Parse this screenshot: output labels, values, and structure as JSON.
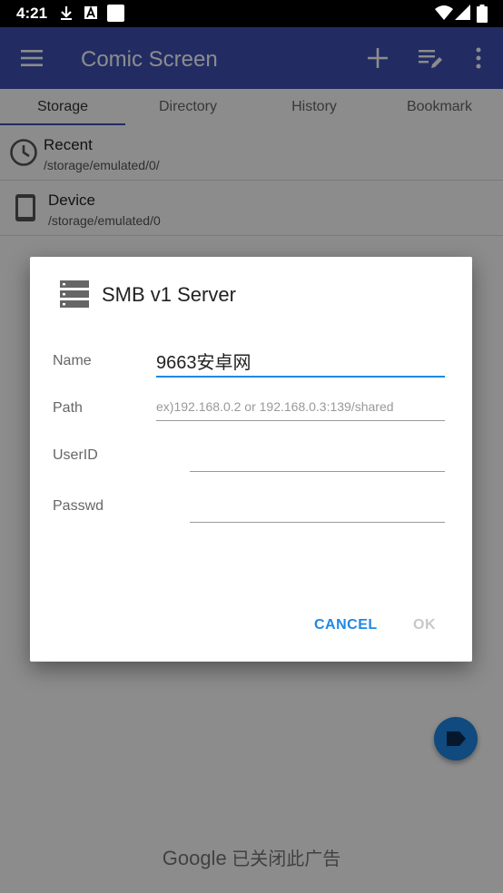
{
  "status_bar": {
    "time": "4:21",
    "icons": [
      "download-icon",
      "text-a-icon",
      "notification-square-icon",
      "wifi-icon",
      "signal-icon",
      "battery-icon"
    ]
  },
  "app_bar": {
    "title": "Comic Screen",
    "icons": [
      "menu-icon",
      "add-icon",
      "edit-list-icon",
      "more-vert-icon"
    ]
  },
  "tabs": [
    {
      "label": "Storage",
      "active": true
    },
    {
      "label": "Directory",
      "active": false
    },
    {
      "label": "History",
      "active": false
    },
    {
      "label": "Bookmark",
      "active": false
    }
  ],
  "storage_items": [
    {
      "title": "Recent",
      "path": "/storage/emulated/0/",
      "icon": "clock-icon"
    },
    {
      "title": "Device",
      "path": "/storage/emulated/0",
      "icon": "phone-icon"
    }
  ],
  "ad": {
    "brand": "Google",
    "text": "已关闭此广告"
  },
  "dialog": {
    "title": "SMB v1 Server",
    "icon": "server-icon",
    "fields": {
      "name": {
        "label": "Name",
        "value": "9663安卓网"
      },
      "path": {
        "label": "Path",
        "placeholder": "ex)192.168.0.2 or 192.168.0.3:139/shared"
      },
      "userid": {
        "label": "UserID",
        "value": ""
      },
      "passwd": {
        "label": "Passwd",
        "value": ""
      }
    },
    "buttons": {
      "cancel": "CANCEL",
      "ok": "OK"
    }
  },
  "colors": {
    "primary": "#3f51b5",
    "accent": "#1e88e5",
    "scrim": "rgba(0,0,0,0.45)"
  }
}
